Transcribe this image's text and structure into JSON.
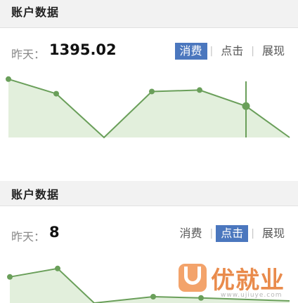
{
  "panels": [
    {
      "title": "账户数据",
      "metric_label": "昨天：",
      "metric_value": "1395.02",
      "tabs": [
        {
          "label": "消费",
          "active": true
        },
        {
          "label": "点击",
          "active": false
        },
        {
          "label": "展现",
          "active": false
        }
      ],
      "separator": "|"
    },
    {
      "title": "账户数据",
      "metric_label": "昨天：",
      "metric_value": "8",
      "tabs": [
        {
          "label": "消费",
          "active": false
        },
        {
          "label": "点击",
          "active": true
        },
        {
          "label": "展现",
          "active": false
        }
      ],
      "separator": "|"
    }
  ],
  "chart_data": [
    {
      "type": "area",
      "series": [
        {
          "values": [
            0.8,
            0.6,
            0.0,
            0.63,
            0.65,
            0.43,
            0.0
          ]
        }
      ],
      "highlight_index": 5,
      "colors": {
        "line": "#6a9f5a",
        "fill": "#e2efdc"
      }
    },
    {
      "type": "area",
      "series": [
        {
          "values": [
            0.62,
            0.82,
            0.0,
            0.15,
            0.12,
            0.05
          ]
        }
      ],
      "colors": {
        "line": "#6a9f5a",
        "fill": "#e2efdc"
      }
    }
  ],
  "watermark": {
    "brand": "优就业",
    "url": "www.ujiuye.com",
    "colors": {
      "badge": "#f3a36b",
      "text": "#e98b4c"
    }
  }
}
